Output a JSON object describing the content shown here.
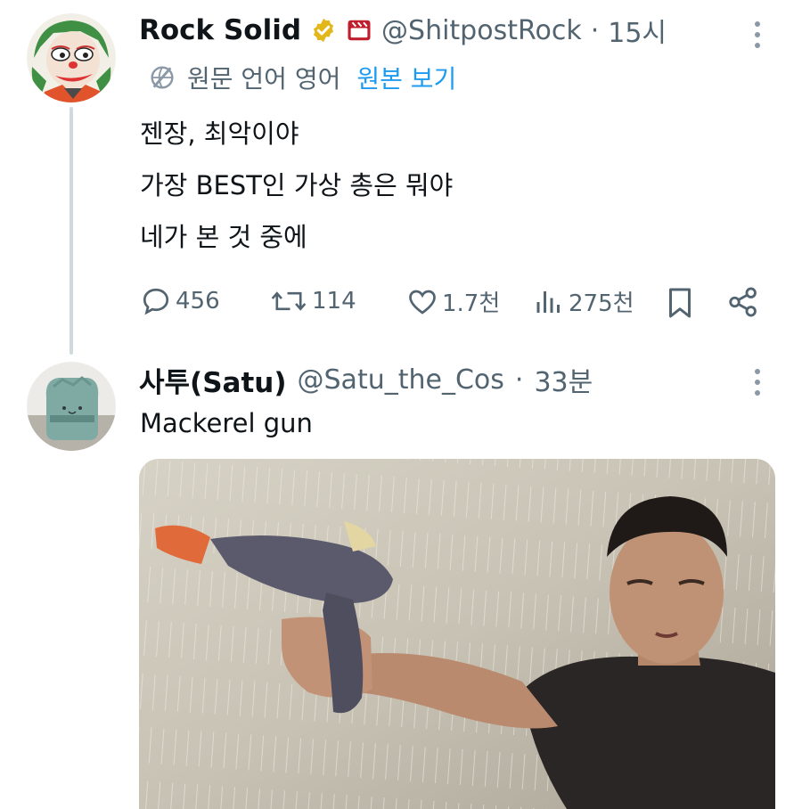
{
  "tweets": [
    {
      "author_name": "Rock Solid",
      "handle": "@ShitpostRock",
      "separator": "·",
      "time": "15시",
      "verified": true,
      "badge_icon": "clapperboard-icon",
      "translated_from": "원문 언어 영어",
      "show_original": "원본 보기",
      "text_lines": [
        "젠장, 최악이야",
        "가장 BEST인 가상 총은 뭐야",
        "네가 본 것 중에"
      ],
      "actions": {
        "replies": "456",
        "retweets": "114",
        "likes": "1.7천",
        "views": "275천"
      }
    },
    {
      "author_name": "사투(Satu)",
      "handle": "@Satu_the_Cos",
      "separator": "·",
      "time": "33분",
      "text": "Mackerel gun"
    }
  ],
  "colors": {
    "text": "#0f1419",
    "secondary": "#536471",
    "link": "#1d9bf0",
    "verified": "#e2b719",
    "badge": "#c01e2e"
  }
}
